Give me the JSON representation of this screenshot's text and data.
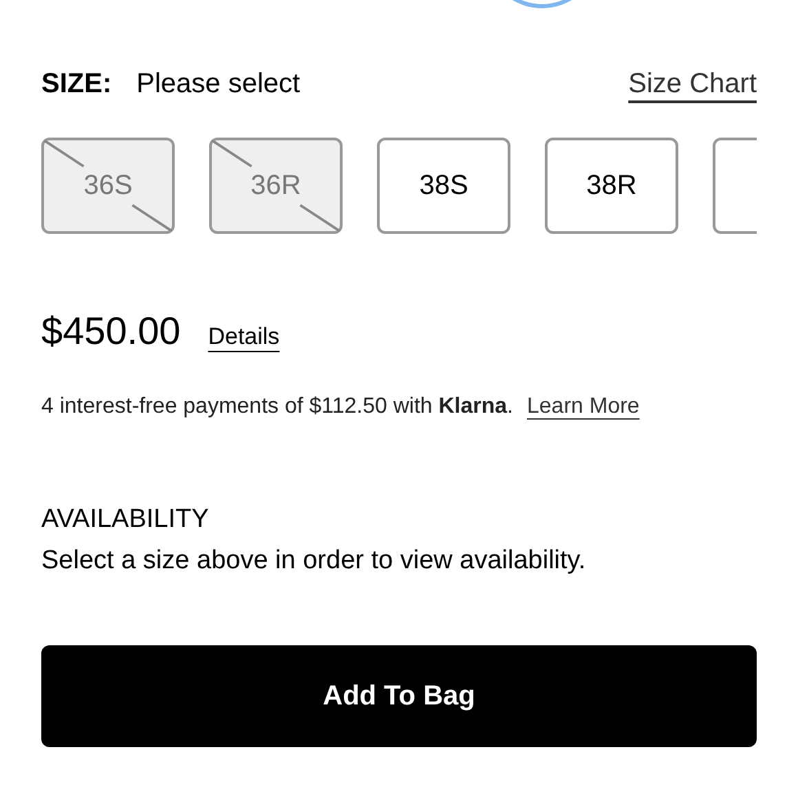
{
  "size_selector": {
    "label": "SIZE:",
    "value": "Please select",
    "size_chart_link": "Size Chart",
    "sizes": [
      {
        "label": "36S",
        "disabled": true
      },
      {
        "label": "36R",
        "disabled": true
      },
      {
        "label": "38S",
        "disabled": false
      },
      {
        "label": "38R",
        "disabled": false
      },
      {
        "disabled": false
      }
    ]
  },
  "price": {
    "amount": "$450.00",
    "details_link": "Details"
  },
  "klarna": {
    "text": "4 interest-free payments of $112.50 with **Klarna**.",
    "link": "Learn More"
  },
  "availability": {
    "heading": "AVAILABILITY",
    "message": "Select a size above in order to view availability."
  },
  "add_to_bag_button": "Add To Bag"
}
